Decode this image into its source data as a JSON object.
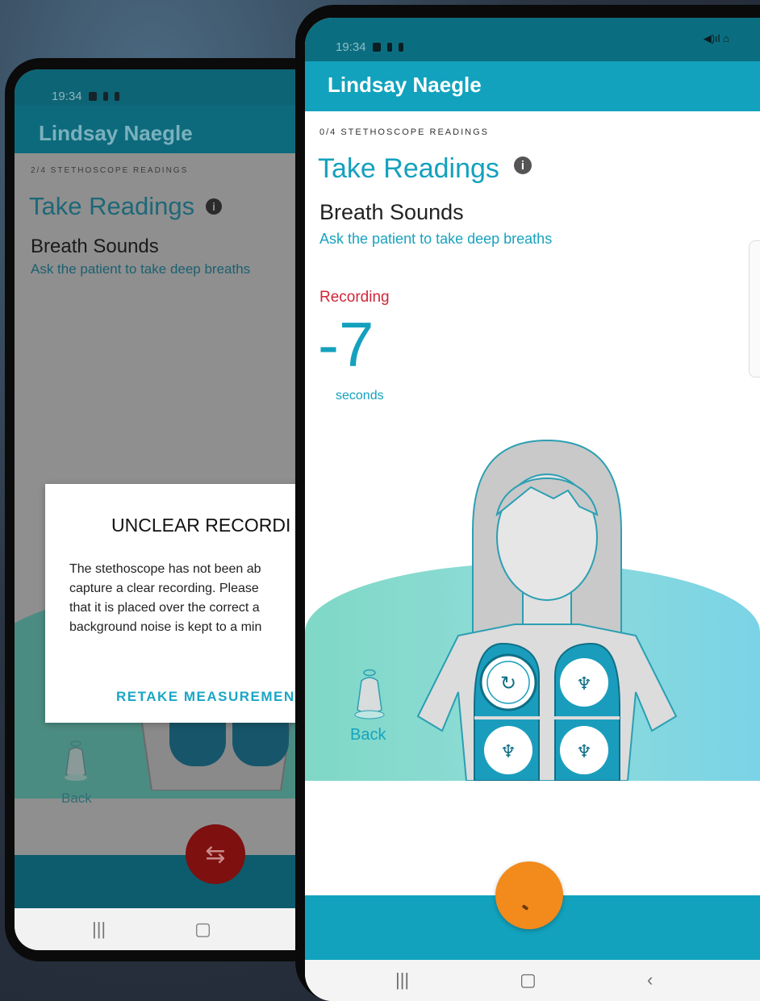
{
  "back_phone": {
    "status_time": "19:34",
    "app_title": "Lindsay Naegle",
    "readings_label": "2/4 STETHOSCOPE READINGS",
    "heading": "Take Readings",
    "info_glyph": "i",
    "section_title": "Breath Sounds",
    "instruction": "Ask the patient to take deep breaths",
    "back_label": "Back",
    "dialog": {
      "title": "UNCLEAR RECORDI",
      "message": "The stethoscope has not been ab\ncapture a clear recording. Please\nthat it is placed over the correct a\nbackground noise is kept to a min",
      "button_label": "RETAKE MEASUREMENT"
    },
    "fab_icon": "swap-icon",
    "fab_glyph": "⇆",
    "nav": {
      "recents_glyph": "|||",
      "home_glyph": "▢"
    }
  },
  "front_phone": {
    "status_time": "19:34",
    "status_right": "◀)ıl ⌂",
    "app_title": "Lindsay Naegle",
    "readings_label": "0/4 STETHOSCOPE READINGS",
    "heading": "Take Readings",
    "info_glyph": "i",
    "section_title": "Breath Sounds",
    "instruction": "Ask the patient to take deep breaths",
    "recording_label": "Recording",
    "countdown": "-7",
    "countdown_unit": "seconds",
    "back_label": "Back",
    "fab_icon": "record-icon",
    "nav": {
      "recents_glyph": "|||",
      "home_glyph": "▢",
      "back_glyph": "‹"
    }
  },
  "colors": {
    "primary": "#12a2bd",
    "primary_dark": "#0b6e80",
    "recording_red": "#d12638",
    "fab_orange": "#f28a1c",
    "lung_blue": "#1a9dbd"
  }
}
